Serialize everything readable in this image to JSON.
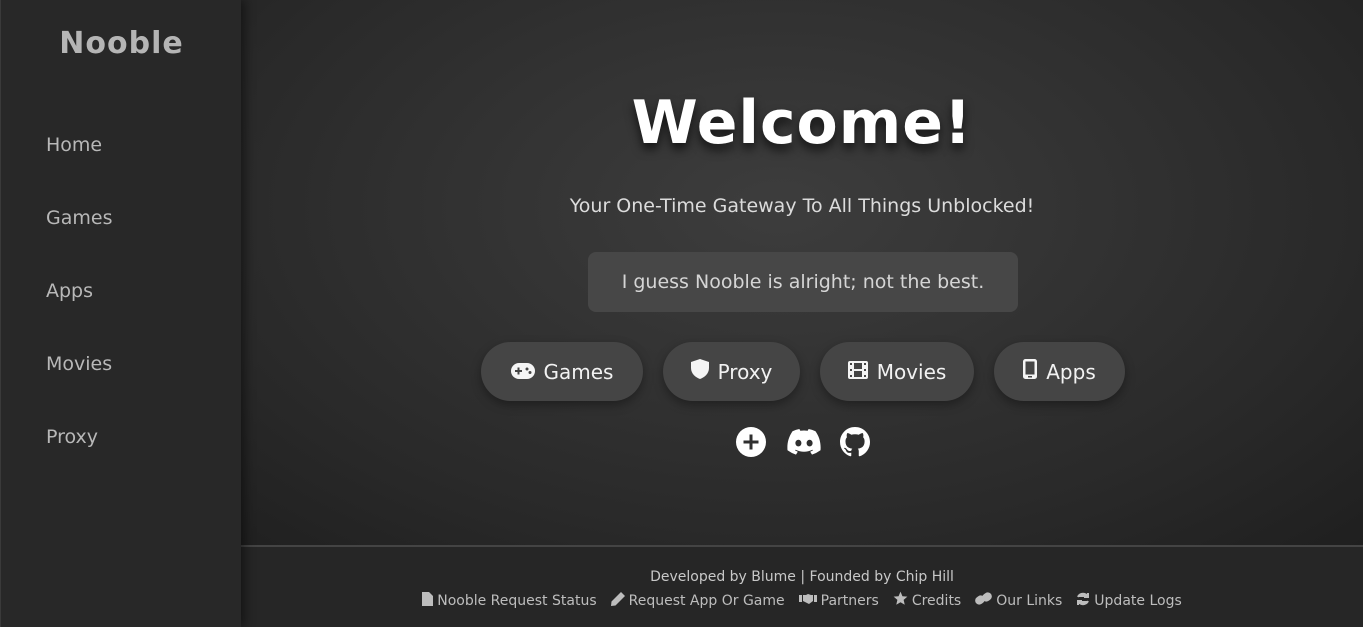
{
  "sidebar": {
    "brand": "Nooble",
    "items": [
      {
        "label": "Home"
      },
      {
        "label": "Games"
      },
      {
        "label": "Apps"
      },
      {
        "label": "Movies"
      },
      {
        "label": "Proxy"
      }
    ]
  },
  "hero": {
    "title": "Welcome!",
    "subtitle": "Your One-Time Gateway To All Things Unblocked!",
    "quote": "I guess Nooble is alright; not the best."
  },
  "buttons": [
    {
      "label": "Games",
      "icon": "gamepad-icon"
    },
    {
      "label": "Proxy",
      "icon": "shield-icon"
    },
    {
      "label": "Movies",
      "icon": "film-icon"
    },
    {
      "label": "Apps",
      "icon": "mobile-icon"
    }
  ],
  "social": [
    "plus-circle-icon",
    "discord-icon",
    "github-icon"
  ],
  "footer": {
    "credit": "Developed by Blume | Founded by Chip Hill",
    "links": [
      {
        "label": "Nooble Request Status",
        "icon": "file-icon"
      },
      {
        "label": "Request App Or Game",
        "icon": "pencil-icon"
      },
      {
        "label": "Partners",
        "icon": "handshake-icon"
      },
      {
        "label": "Credits",
        "icon": "star-icon"
      },
      {
        "label": "Our Links",
        "icon": "link-icon"
      },
      {
        "label": "Update Logs",
        "icon": "refresh-icon"
      }
    ]
  },
  "colors": {
    "background": "#2a2a2a",
    "sidebar": "#282828",
    "button": "#454545",
    "text": "#ffffff"
  }
}
